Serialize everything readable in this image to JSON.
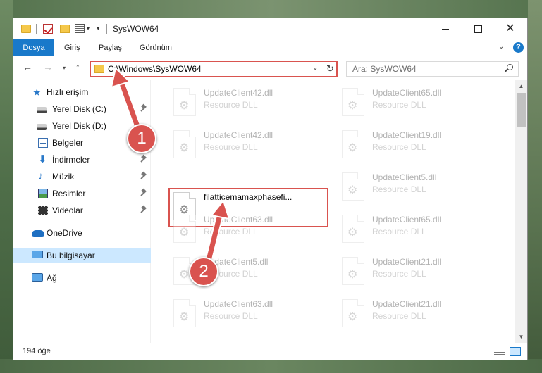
{
  "window": {
    "title": "SysWOW64"
  },
  "ribbon": {
    "tabs": [
      "Dosya",
      "Giriş",
      "Paylaş",
      "Görünüm"
    ],
    "help": "?"
  },
  "nav": {
    "back": "←",
    "forward": "→",
    "up": "↑",
    "address": "C:\\Windows\\SysWOW64",
    "search_placeholder": "Ara: SysWOW64"
  },
  "sidebar": {
    "items": [
      {
        "label": "Hızlı erişim",
        "icon": "star-icon",
        "pinned": false
      },
      {
        "label": "Yerel Disk (C:)",
        "icon": "disk-icon",
        "pinned": true
      },
      {
        "label": "Yerel Disk (D:)",
        "icon": "disk-icon",
        "pinned": false
      },
      {
        "label": "Belgeler",
        "icon": "documents-icon",
        "pinned": false
      },
      {
        "label": "İndirmeler",
        "icon": "download-icon",
        "pinned": true
      },
      {
        "label": "Müzik",
        "icon": "music-icon",
        "pinned": true
      },
      {
        "label": "Resimler",
        "icon": "pictures-icon",
        "pinned": true
      },
      {
        "label": "Videolar",
        "icon": "videos-icon",
        "pinned": true
      },
      {
        "label": "OneDrive",
        "icon": "cloud-icon",
        "pinned": false
      },
      {
        "label": "Bu bilgisayar",
        "icon": "computer-icon",
        "pinned": false,
        "selected": true
      },
      {
        "label": "Ağ",
        "icon": "network-icon",
        "pinned": false
      }
    ]
  },
  "files": {
    "left": [
      {
        "name": "UpdateClient42.dll",
        "type": "Resource DLL",
        "faded": true
      },
      {
        "name": "UpdateClient42.dll",
        "type": "Resource DLL",
        "faded": true
      },
      {
        "name": "filatticemamaxphasefi...",
        "type": "",
        "faded": false
      },
      {
        "name": "UpdateClient63.dll",
        "type": "Resource DLL",
        "faded": true
      },
      {
        "name": "UpdateClient5.dll",
        "type": "Resource DLL",
        "faded": true
      },
      {
        "name": "UpdateClient63.dll",
        "type": "Resource DLL",
        "faded": true
      }
    ],
    "right": [
      {
        "name": "UpdateClient65.dll",
        "type": "Resource DLL",
        "faded": true
      },
      {
        "name": "UpdateClient19.dll",
        "type": "Resource DLL",
        "faded": true
      },
      {
        "name": "UpdateClient5.dll",
        "type": "Resource DLL",
        "faded": true
      },
      {
        "name": "UpdateClient65.dll",
        "type": "Resource DLL",
        "faded": true
      },
      {
        "name": "UpdateClient21.dll",
        "type": "Resource DLL",
        "faded": true
      },
      {
        "name": "UpdateClient21.dll",
        "type": "Resource DLL",
        "faded": true
      }
    ]
  },
  "status": {
    "count": "194 öğe"
  },
  "annotations": {
    "step1": "1",
    "step2": "2",
    "color": "#d9534f"
  }
}
